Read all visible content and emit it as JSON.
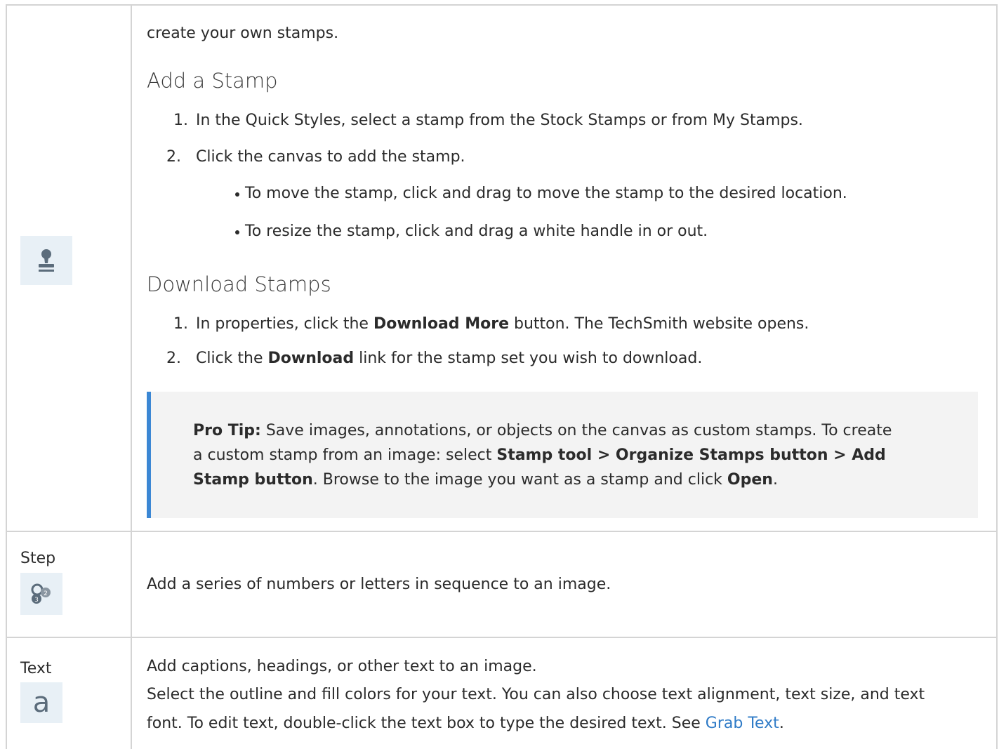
{
  "stamp_row": {
    "intro": "create your own stamps.",
    "add_heading": "Add a Stamp",
    "add_steps": [
      "In the Quick Styles, select a stamp from the Stock Stamps or from My Stamps.",
      "Click the canvas to add the stamp."
    ],
    "add_bullets": [
      "To move the stamp, click and drag to move the stamp to the desired location.",
      "To resize the stamp, click and drag a white handle in or out."
    ],
    "download_heading": "Download Stamps",
    "download_step1_pre": "In properties, click the ",
    "download_step1_bold": "Download More",
    "download_step1_post": " button. The TechSmith website opens.",
    "download_step2_pre": "Click the ",
    "download_step2_bold": "Download",
    "download_step2_post": " link for the stamp set you wish to download.",
    "tip": {
      "label": "Pro Tip:",
      "line1": " Save images, annotations, or objects on the canvas as custom stamps. To create",
      "line2_pre": "a custom stamp from an image: select ",
      "line2_bold": "Stamp tool > Organize Stamps button > Add",
      "line3_bold": "Stamp button",
      "line3_mid": ". Browse to the image you want as a stamp and click ",
      "line3_bold2": "Open",
      "line3_post": "."
    },
    "icon": "stamp-icon"
  },
  "step_row": {
    "label": "Step",
    "description": "Add a series of numbers or letters in sequence to an image.",
    "icon": "step-icon"
  },
  "text_row": {
    "label": "Text",
    "line1": "Add captions, headings, or other text to an image.",
    "line2": "Select the outline and fill colors for your text. You can also choose text alignment, text size, and text",
    "line3_pre": "font. To edit text, double-click the text box to type the desired text. See ",
    "line3_link": "Grab Text",
    "line3_post": ".",
    "icon": "text-tool-icon"
  },
  "colors": {
    "tip_accent": "#3b87d4",
    "link": "#2f7bc7",
    "icon_bg": "#e8f0f6",
    "tip_bg": "#f3f3f3"
  }
}
